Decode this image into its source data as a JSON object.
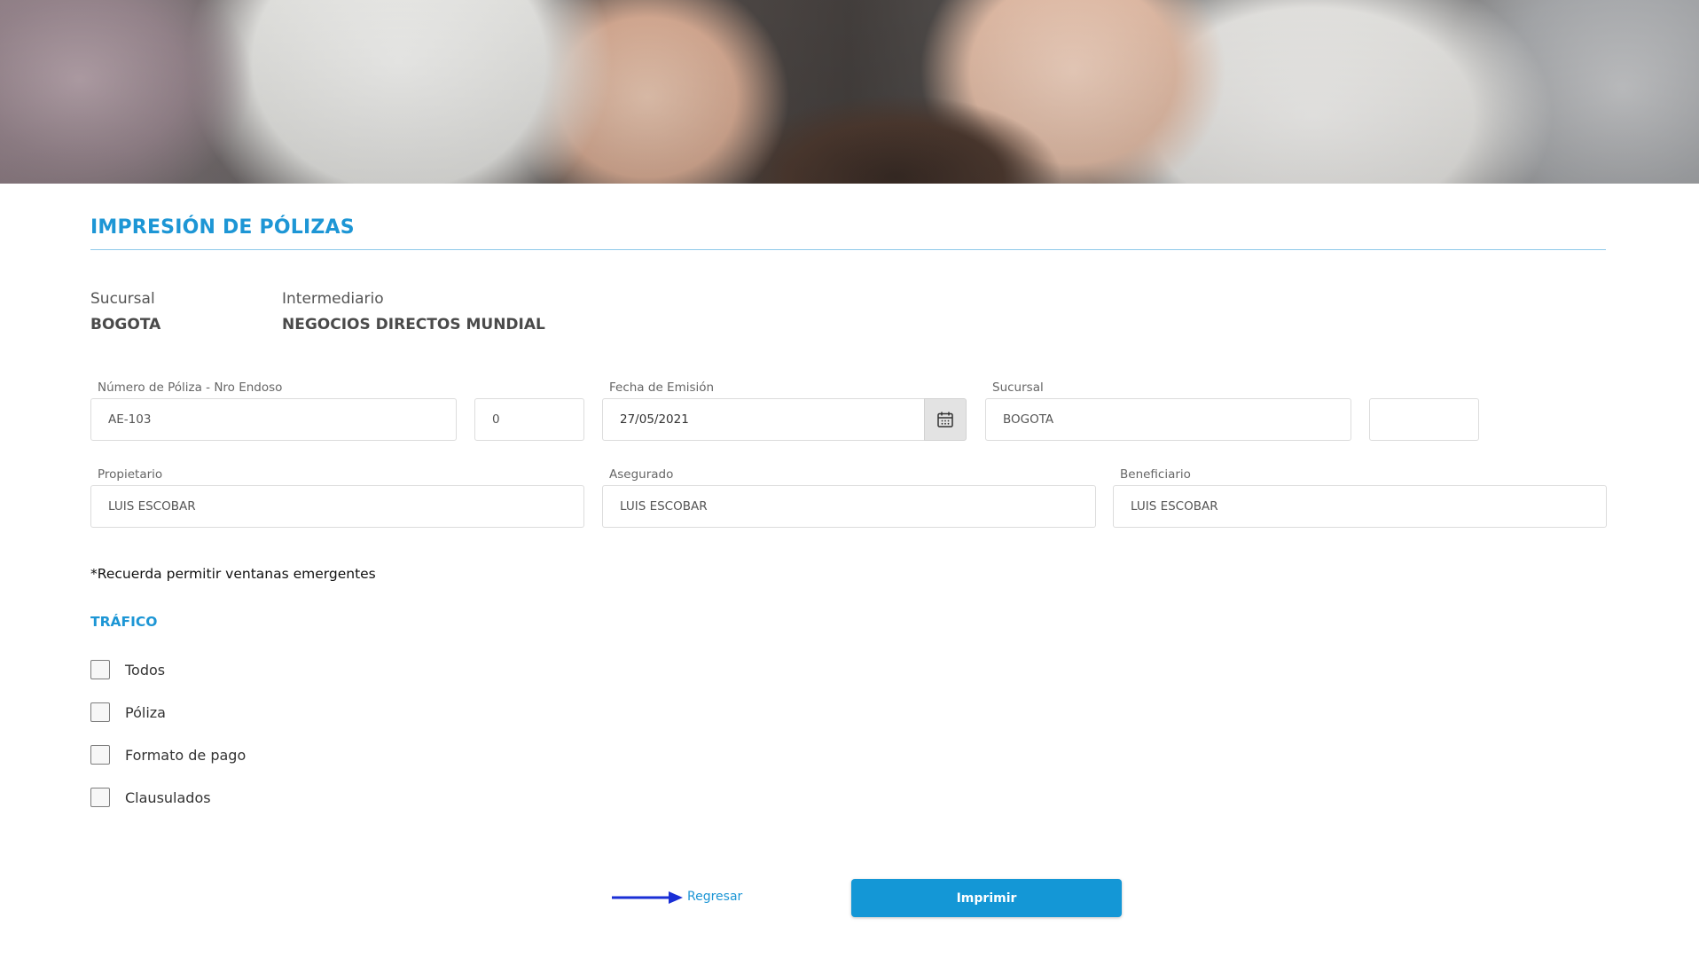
{
  "page": {
    "title": "IMPRESIÓN DE PÓLIZAS"
  },
  "info": {
    "sucursal_label": "Sucursal",
    "sucursal_value": "BOGOTA",
    "intermediario_label": "Intermediario",
    "intermediario_value": "NEGOCIOS DIRECTOS MUNDIAL"
  },
  "form": {
    "poliza_label": "Número de Póliza - Nro Endoso",
    "poliza_value": "AE-103",
    "endoso_value": "0",
    "fecha_label": "Fecha de Emisión",
    "fecha_value": "27/05/2021",
    "sucursal_label": "Sucursal",
    "sucursal_value": "BOGOTA",
    "extra_value": "",
    "propietario_label": "Propietario",
    "propietario_value": "LUIS ESCOBAR",
    "asegurado_label": "Asegurado",
    "asegurado_value": "LUIS ESCOBAR",
    "beneficiario_label": "Beneficiario",
    "beneficiario_value": "LUIS ESCOBAR"
  },
  "note": "*Recuerda permitir ventanas emergentes",
  "section": {
    "title": "TRÁFICO",
    "options": [
      {
        "label": "Todos",
        "checked": false
      },
      {
        "label": "Póliza",
        "checked": false
      },
      {
        "label": "Formato de pago",
        "checked": false
      },
      {
        "label": "Clausulados",
        "checked": false
      }
    ]
  },
  "actions": {
    "back_label": "Regresar",
    "print_label": "Imprimir"
  },
  "colors": {
    "accent": "#1d96d5",
    "button": "#1497d6",
    "arrow": "#1a2fd6"
  }
}
